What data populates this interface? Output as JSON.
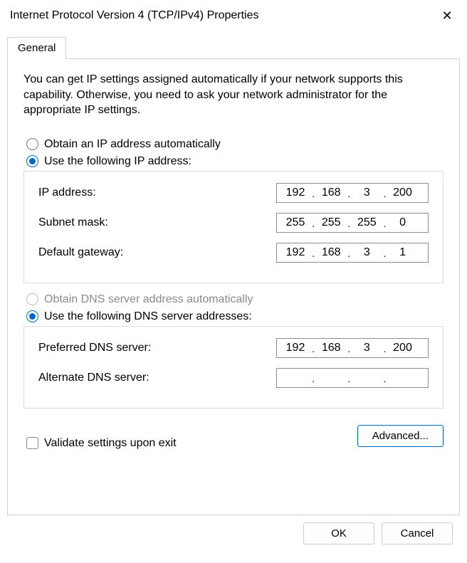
{
  "titlebar": {
    "title": "Internet Protocol Version 4 (TCP/IPv4) Properties",
    "close_glyph": "✕"
  },
  "tab": {
    "general": "General"
  },
  "intro_text": "You can get IP settings assigned automatically if your network supports this capability. Otherwise, you need to ask your network administrator for the appropriate IP settings.",
  "section_ip": {
    "radio_auto": "Obtain an IP address automatically",
    "radio_manual": "Use the following IP address:",
    "ip_label": "IP address:",
    "ip": [
      "192",
      "168",
      "3",
      "200"
    ],
    "mask_label": "Subnet mask:",
    "mask": [
      "255",
      "255",
      "255",
      "0"
    ],
    "gw_label": "Default gateway:",
    "gw": [
      "192",
      "168",
      "3",
      "1"
    ]
  },
  "section_dns": {
    "radio_auto": "Obtain DNS server address automatically",
    "radio_manual": "Use the following DNS server addresses:",
    "pref_label": "Preferred DNS server:",
    "pref": [
      "192",
      "168",
      "3",
      "200"
    ],
    "alt_label": "Alternate DNS server:",
    "alt": [
      "",
      "",
      "",
      ""
    ]
  },
  "checkbox_validate": "Validate settings upon exit",
  "buttons": {
    "advanced": "Advanced...",
    "ok": "OK",
    "cancel": "Cancel"
  }
}
